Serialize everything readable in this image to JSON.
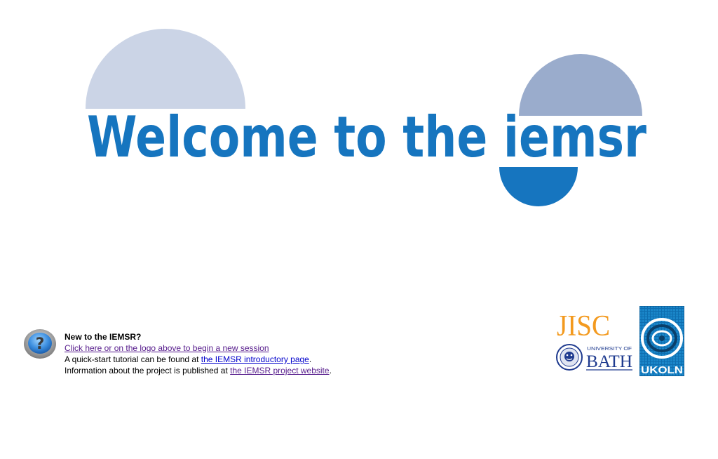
{
  "logo": {
    "welcome_text": "Welcome to the iemsr"
  },
  "help": {
    "icon": "question-mark-icon",
    "heading": "New to the IEMSR?",
    "session_link": "Click here or on the logo above to begin a new session",
    "tutorial_prefix": "A quick-start tutorial can be found at ",
    "tutorial_link": "the IEMSR introductory page",
    "tutorial_suffix": ".",
    "project_prefix": "Information about the project is published at ",
    "project_link": "the IEMSR project website",
    "project_suffix": "."
  },
  "partners": {
    "jisc": "JISC",
    "bath_university_of": "UNIVERSITY OF",
    "bath_name": "BATH",
    "ukoln": "UKOLN"
  },
  "colors": {
    "logo_blue": "#1675bf",
    "pale_circle": "#cbd4e6",
    "mid_circle": "#9aaccc",
    "jisc_orange": "#f39a1f",
    "link_visited": "#551a8b",
    "link_blue": "#0000cc"
  }
}
